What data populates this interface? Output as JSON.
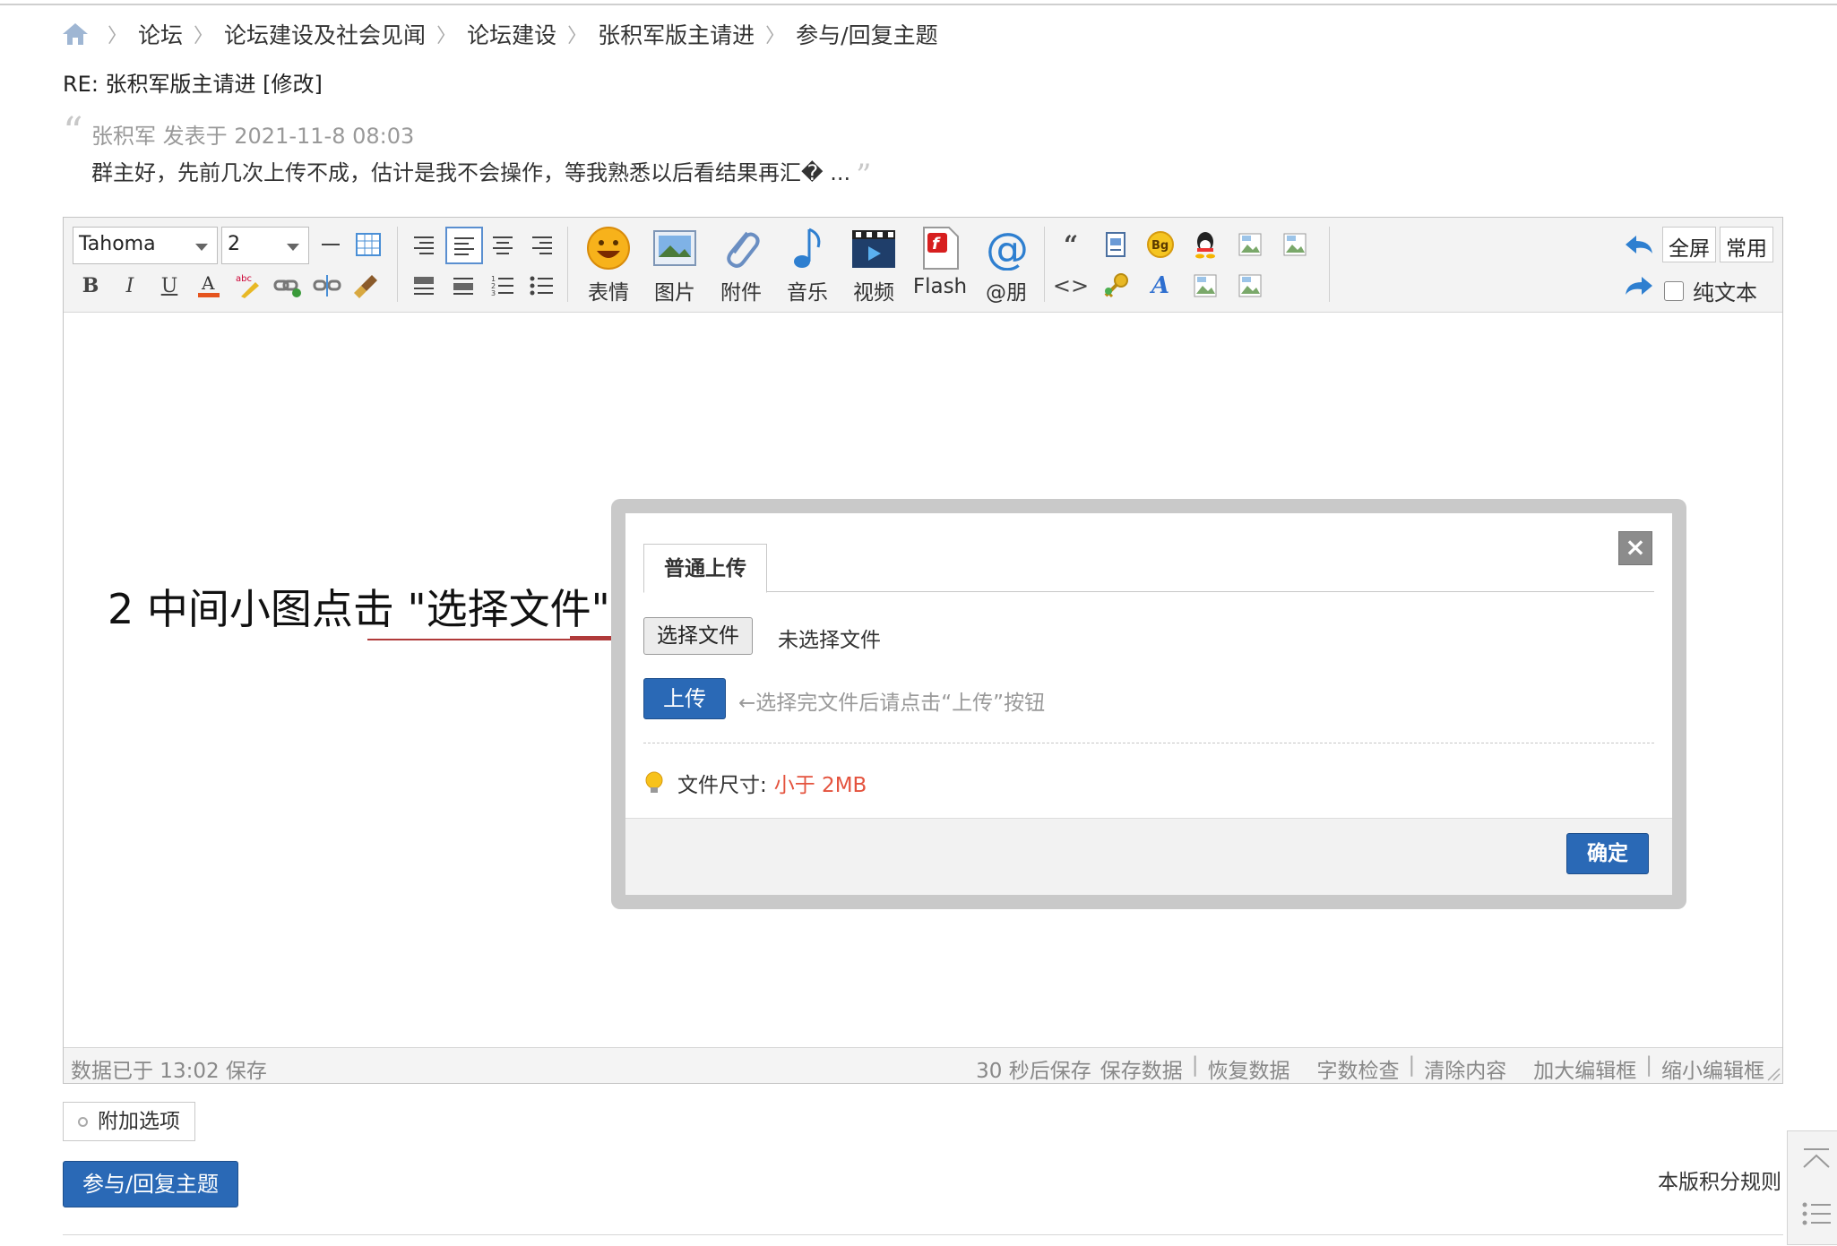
{
  "breadcrumb": {
    "items": [
      "论坛",
      "论坛建设及社会见闻",
      "论坛建设",
      "张积军版主请进",
      "参与/回复主题"
    ]
  },
  "post_title": "RE: 张积军版主请进 [修改]",
  "quote": {
    "meta": "张积军 发表于 2021-11-8 08:03",
    "body": "群主好，先前几次上传不成，估计是我不会操作，等我熟悉以后看结果再汇� ..."
  },
  "toolbar": {
    "font_family": "Tahoma",
    "font_size": "2",
    "buttons": {
      "emoji": "表情",
      "image": "图片",
      "attachment": "附件",
      "music": "音乐",
      "video": "视频",
      "flash": "Flash",
      "mention": "@朋"
    },
    "fullscreen": "全屏",
    "common": "常用",
    "plain_text": "纯文本"
  },
  "status": {
    "saved_at": "数据已于 13:02 保存",
    "autosave": "30 秒后保存",
    "save_data": "保存数据",
    "restore_data": "恢复数据",
    "word_check": "字数检查",
    "clear": "清除内容",
    "enlarge": "加大编辑框",
    "shrink": "缩小编辑框"
  },
  "annotation": "2 中间小图点击 \"选择文件\".",
  "dialog": {
    "tab": "普通上传",
    "close": "×",
    "choose_file": "选择文件",
    "no_file": "未选择文件",
    "upload": "上传",
    "upload_hint": "←选择完文件后请点击“上传”按钮",
    "size_label": "文件尺寸:",
    "size_value": "小于 2MB",
    "ok": "确定"
  },
  "extra_options": "附加选项",
  "submit": "参与/回复主题",
  "rules_link": "本版积分规则",
  "colors": {
    "primary_button": "#2a69b6",
    "size_value": "#e4533e",
    "annotation_line": "#b03a3a"
  }
}
